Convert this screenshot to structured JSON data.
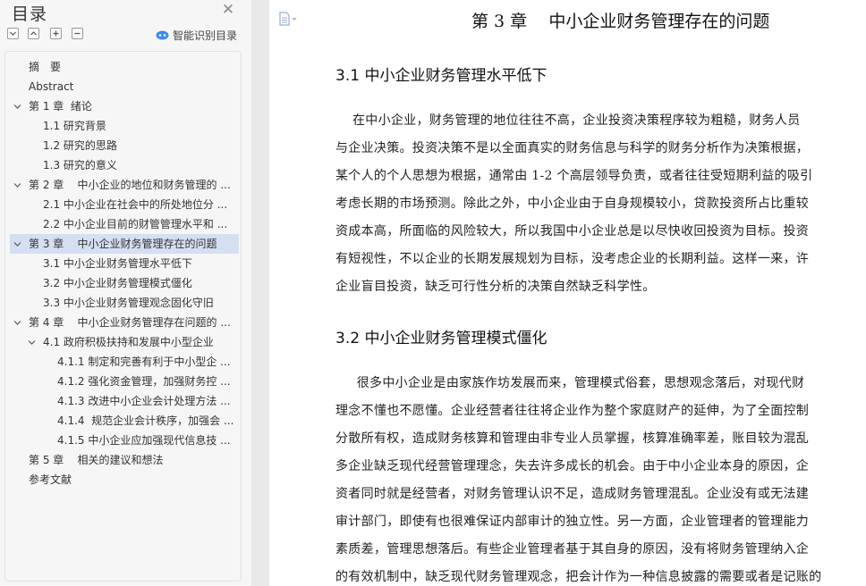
{
  "toc": {
    "title": "目录",
    "smart_label": "智能识别目录",
    "items": [
      {
        "label": "摘　要",
        "level": 0
      },
      {
        "label": "Abstract",
        "level": 0
      },
      {
        "label": "第 1 章  绪论",
        "level": 0,
        "expanded": true
      },
      {
        "label": "1.1 研究背景",
        "level": 1
      },
      {
        "label": "1.2 研究的思路",
        "level": 1
      },
      {
        "label": "1.3 研究的意义",
        "level": 1
      },
      {
        "label": "第 2 章    中小企业的地位和财务管理的 ...",
        "level": 0,
        "expanded": true
      },
      {
        "label": "2.1 中小企业在社会中的所处地位分 ...",
        "level": 1
      },
      {
        "label": "2.2 中小企业目前的财管管理水平和 ...",
        "level": 1
      },
      {
        "label": "第 3 章    中小企业财务管理存在的问题",
        "level": 0,
        "expanded": true,
        "active": true
      },
      {
        "label": "3.1 中小企业财务管理水平低下",
        "level": 1
      },
      {
        "label": "3.2 中小企业财务管理模式僵化",
        "level": 1
      },
      {
        "label": "3.3 中小企业财务管理观念固化守旧",
        "level": 1
      },
      {
        "label": "第 4 章    中小企业财务管理存在问题的 ...",
        "level": 0,
        "expanded": true
      },
      {
        "label": "4.1 政府积极扶持和发展中小型企业",
        "level": 1,
        "expanded": true
      },
      {
        "label": "4.1.1 制定和完善有利于中小型企 ...",
        "level": 2
      },
      {
        "label": "4.1.2 强化资金管理，加强财务控 ...",
        "level": 2
      },
      {
        "label": "4.1.3 改进中小企业会计处理方法 ...",
        "level": 2
      },
      {
        "label": "4.1.4  规范企业会计秩序，加强会 ...",
        "level": 2
      },
      {
        "label": "4.1.5 中小企业应加强现代信息技 ...",
        "level": 2
      },
      {
        "label": "第 5 章    相关的建议和想法",
        "level": 0
      },
      {
        "label": "参考文献",
        "level": 0
      }
    ]
  },
  "document": {
    "chapter_title": "第 3 章    中小企业财务管理存在的问题",
    "sections": [
      {
        "heading": "3.1 中小企业财务管理水平低下",
        "lines": [
          "    在中小企业，财务管理的地位往往不高，企业投资决策程序较为粗糙，财务人员",
          "与企业决策。投资决策不是以全面真实的财务信息与科学的财务分析作为决策根据，",
          "某个人的个人思想为根据，通常由 1-2 个高层领导负责，或者往往受短期利益的吸引",
          "考虑长期的市场预测。除此之外，中小企业由于自身规模较小，贷款投资所占比重较",
          "资成本高，所面临的风险较大，所以我国中小企业总是以尽快收回投资为目标。投资",
          "有短视性，不以企业的长期发展规划为目标，没考虑企业的长期利益。这样一来，许",
          "企业盲目投资，缺乏可行性分析的决策自然缺乏科学性。"
        ]
      },
      {
        "heading": "3.2 中小企业财务管理模式僵化",
        "lines": [
          "     很多中小企业是由家族作坊发展而来，管理模式俗套，思想观念落后，对现代财",
          "理念不懂也不愿懂。企业经营者往往将企业作为整个家庭财产的延伸，为了全面控制",
          "分散所有权，造成财务核算和管理由非专业人员掌握，核算准确率差，账目较为混乱",
          "多企业缺乏现代经营管理理念，失去许多成长的机会。由于中小企业本身的原因，企",
          "资者同时就是经营者，对财务管理认识不足，造成财务管理混乱。企业没有或无法建",
          "审计部门，即使有也很难保证内部审计的独立性。另一方面，企业管理者的管理能力",
          "素质差，管理思想落后。有些企业管理者基于其自身的原因，没有将财务管理纳入企",
          "的有效机制中，缺乏现代财务管理观念，把会计作为一种信息披露的需要或者是记账的"
        ]
      }
    ]
  },
  "colors": {
    "active_item_bg": "#d5dff2",
    "panel_bg": "#f6f6f6",
    "smart_icon": "#3d8bef"
  }
}
